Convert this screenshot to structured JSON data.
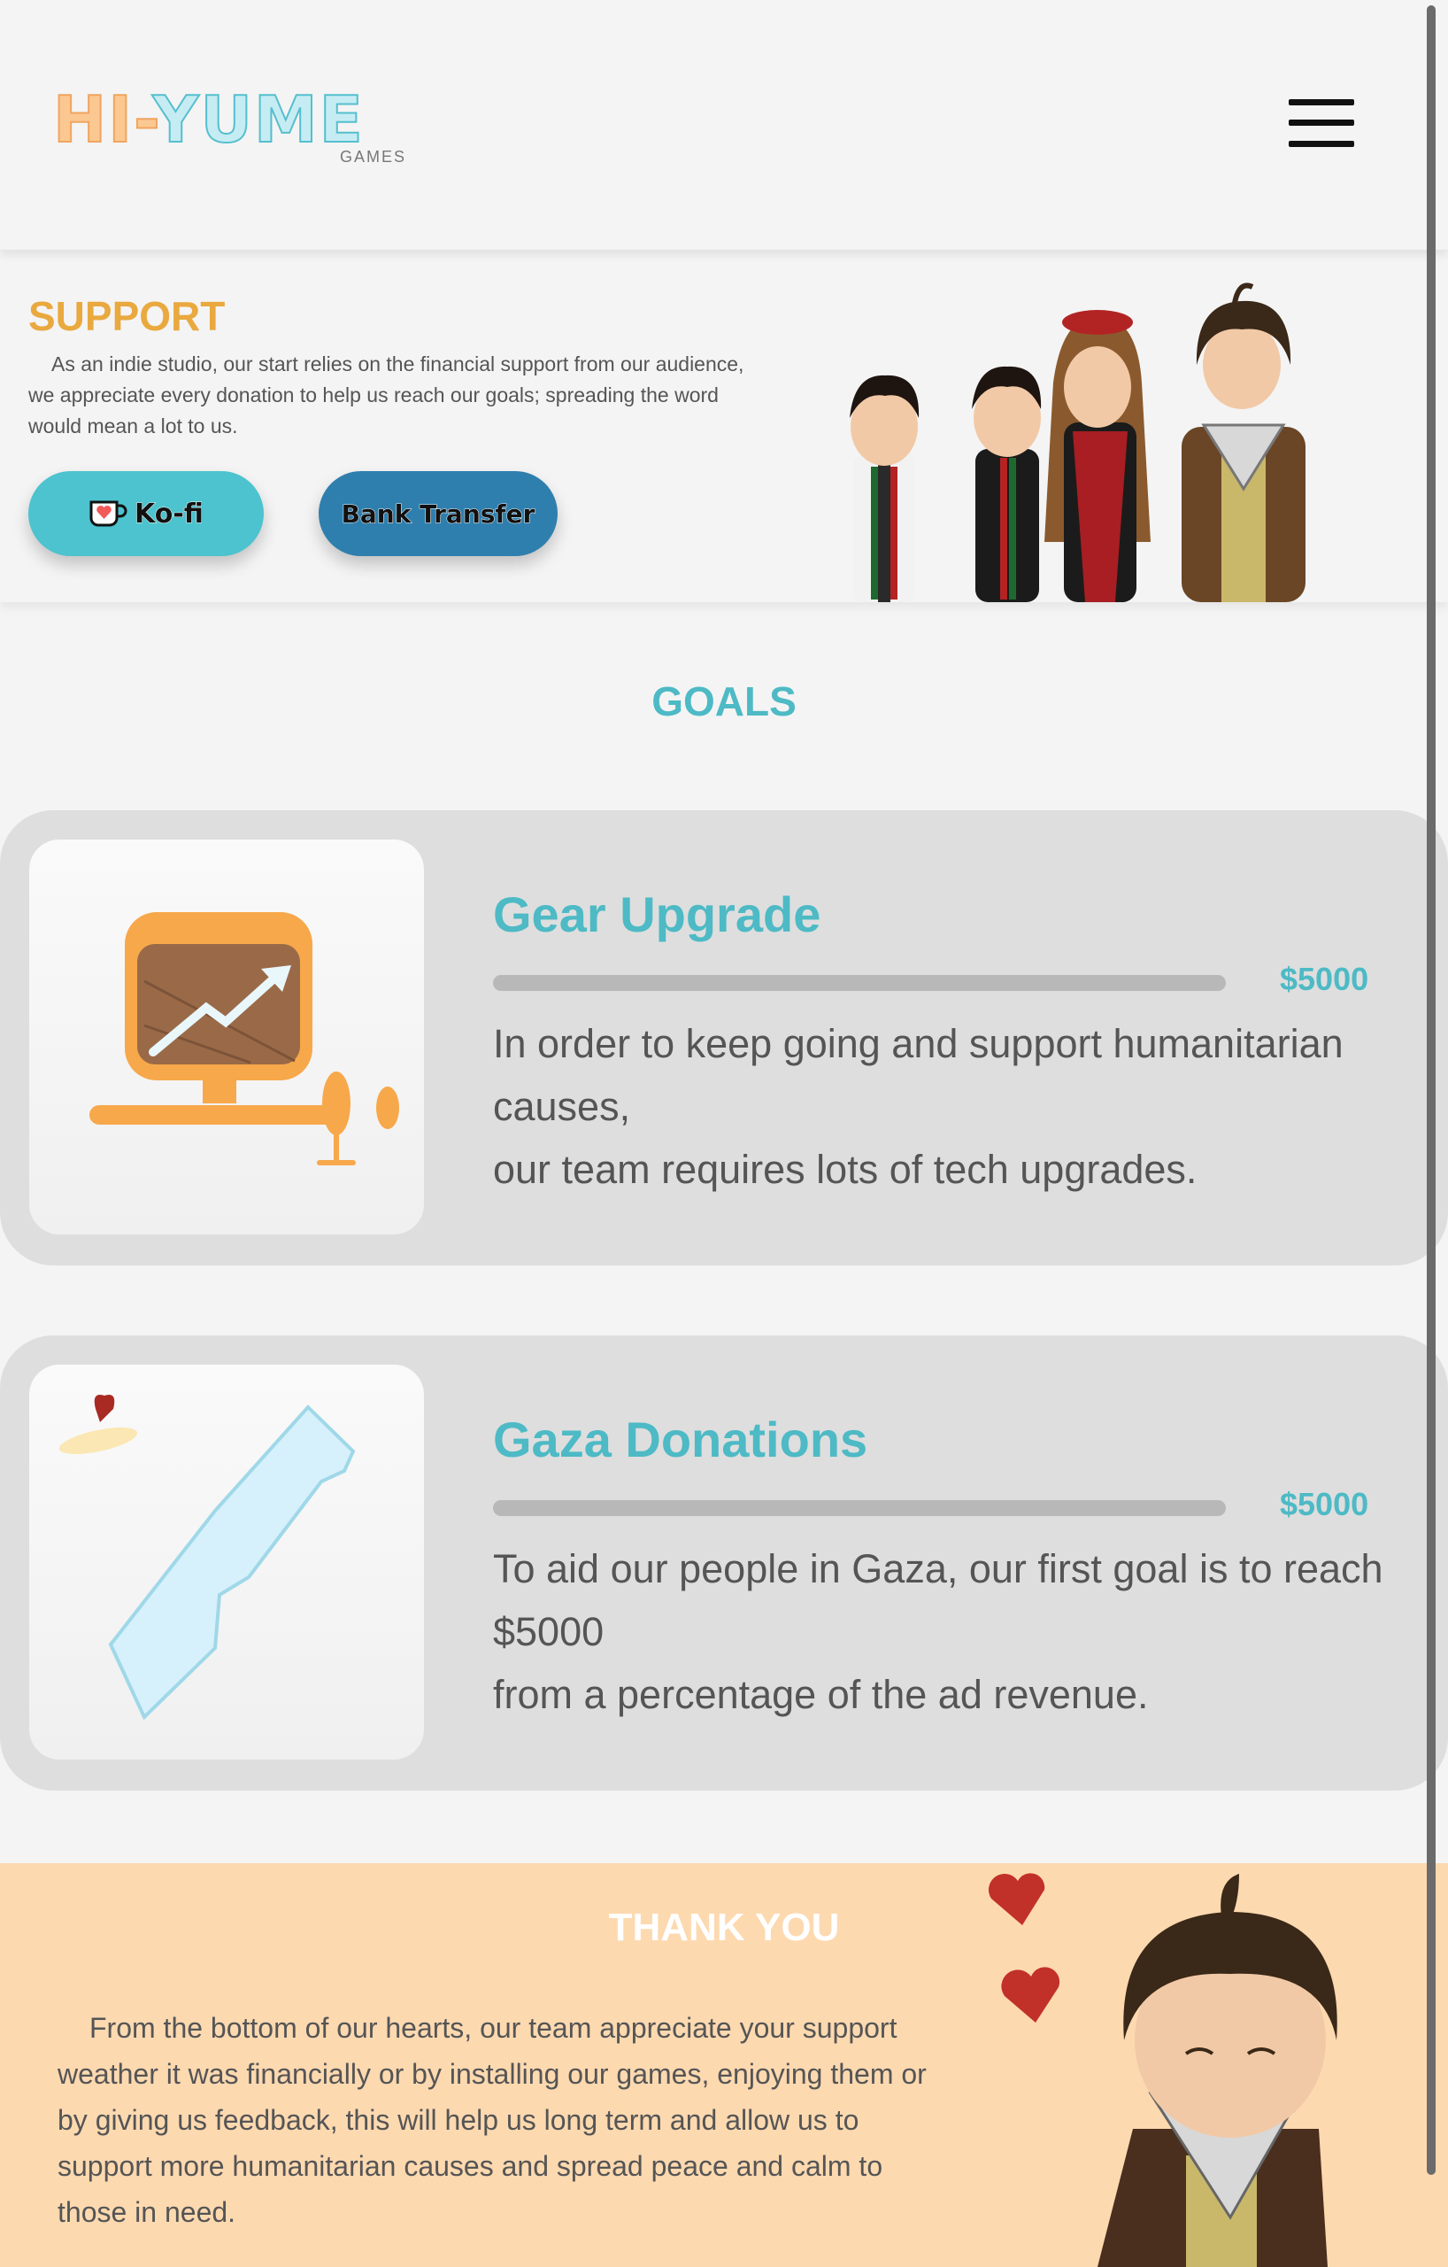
{
  "header": {
    "logo_main_hi": "HI-",
    "logo_main_yume": "YUME",
    "logo_sub": "GAMES",
    "menu_icon": "hamburger-menu-icon"
  },
  "support": {
    "title": "SUPPORT",
    "text": "As an indie studio, our start relies on the financial support from our audience, we appreciate every donation to help us reach our goals; spreading the word would mean a lot to us.",
    "kofi_label": "Ko-fi",
    "bank_label": "Bank Transfer",
    "kofi_icon": "kofi-cup-heart-icon"
  },
  "goals": {
    "title": "GOALS",
    "items": [
      {
        "name": "Gear Upgrade",
        "amount": "$5000",
        "progress": 0,
        "desc_line1": "In order to keep going and support humanitarian causes,",
        "desc_line2": "our team requires lots of tech upgrades.",
        "image": "computer-growth-illustration"
      },
      {
        "name": "Gaza Donations",
        "amount": "$5000",
        "progress": 0,
        "desc_line1": "To aid our people in Gaza, our first goal is to reach $5000",
        "desc_line2": "from a percentage of the ad revenue.",
        "image": "gaza-map-illustration"
      }
    ]
  },
  "thanks": {
    "title": "THANK YOU",
    "text": "From the bottom of our hearts, our team appreciate your support weather it was financially or by installing our games, enjoying them or by giving us feedback, this will help us long term and allow us to support more humanitarian causes and spread peace and calm to those in need."
  },
  "colors": {
    "accent_teal": "#4dbac5",
    "accent_orange": "#e9a93f",
    "kofi_button": "#4cc3ce",
    "bank_button": "#2f7fae",
    "thanks_bg": "#fdd9b0"
  }
}
